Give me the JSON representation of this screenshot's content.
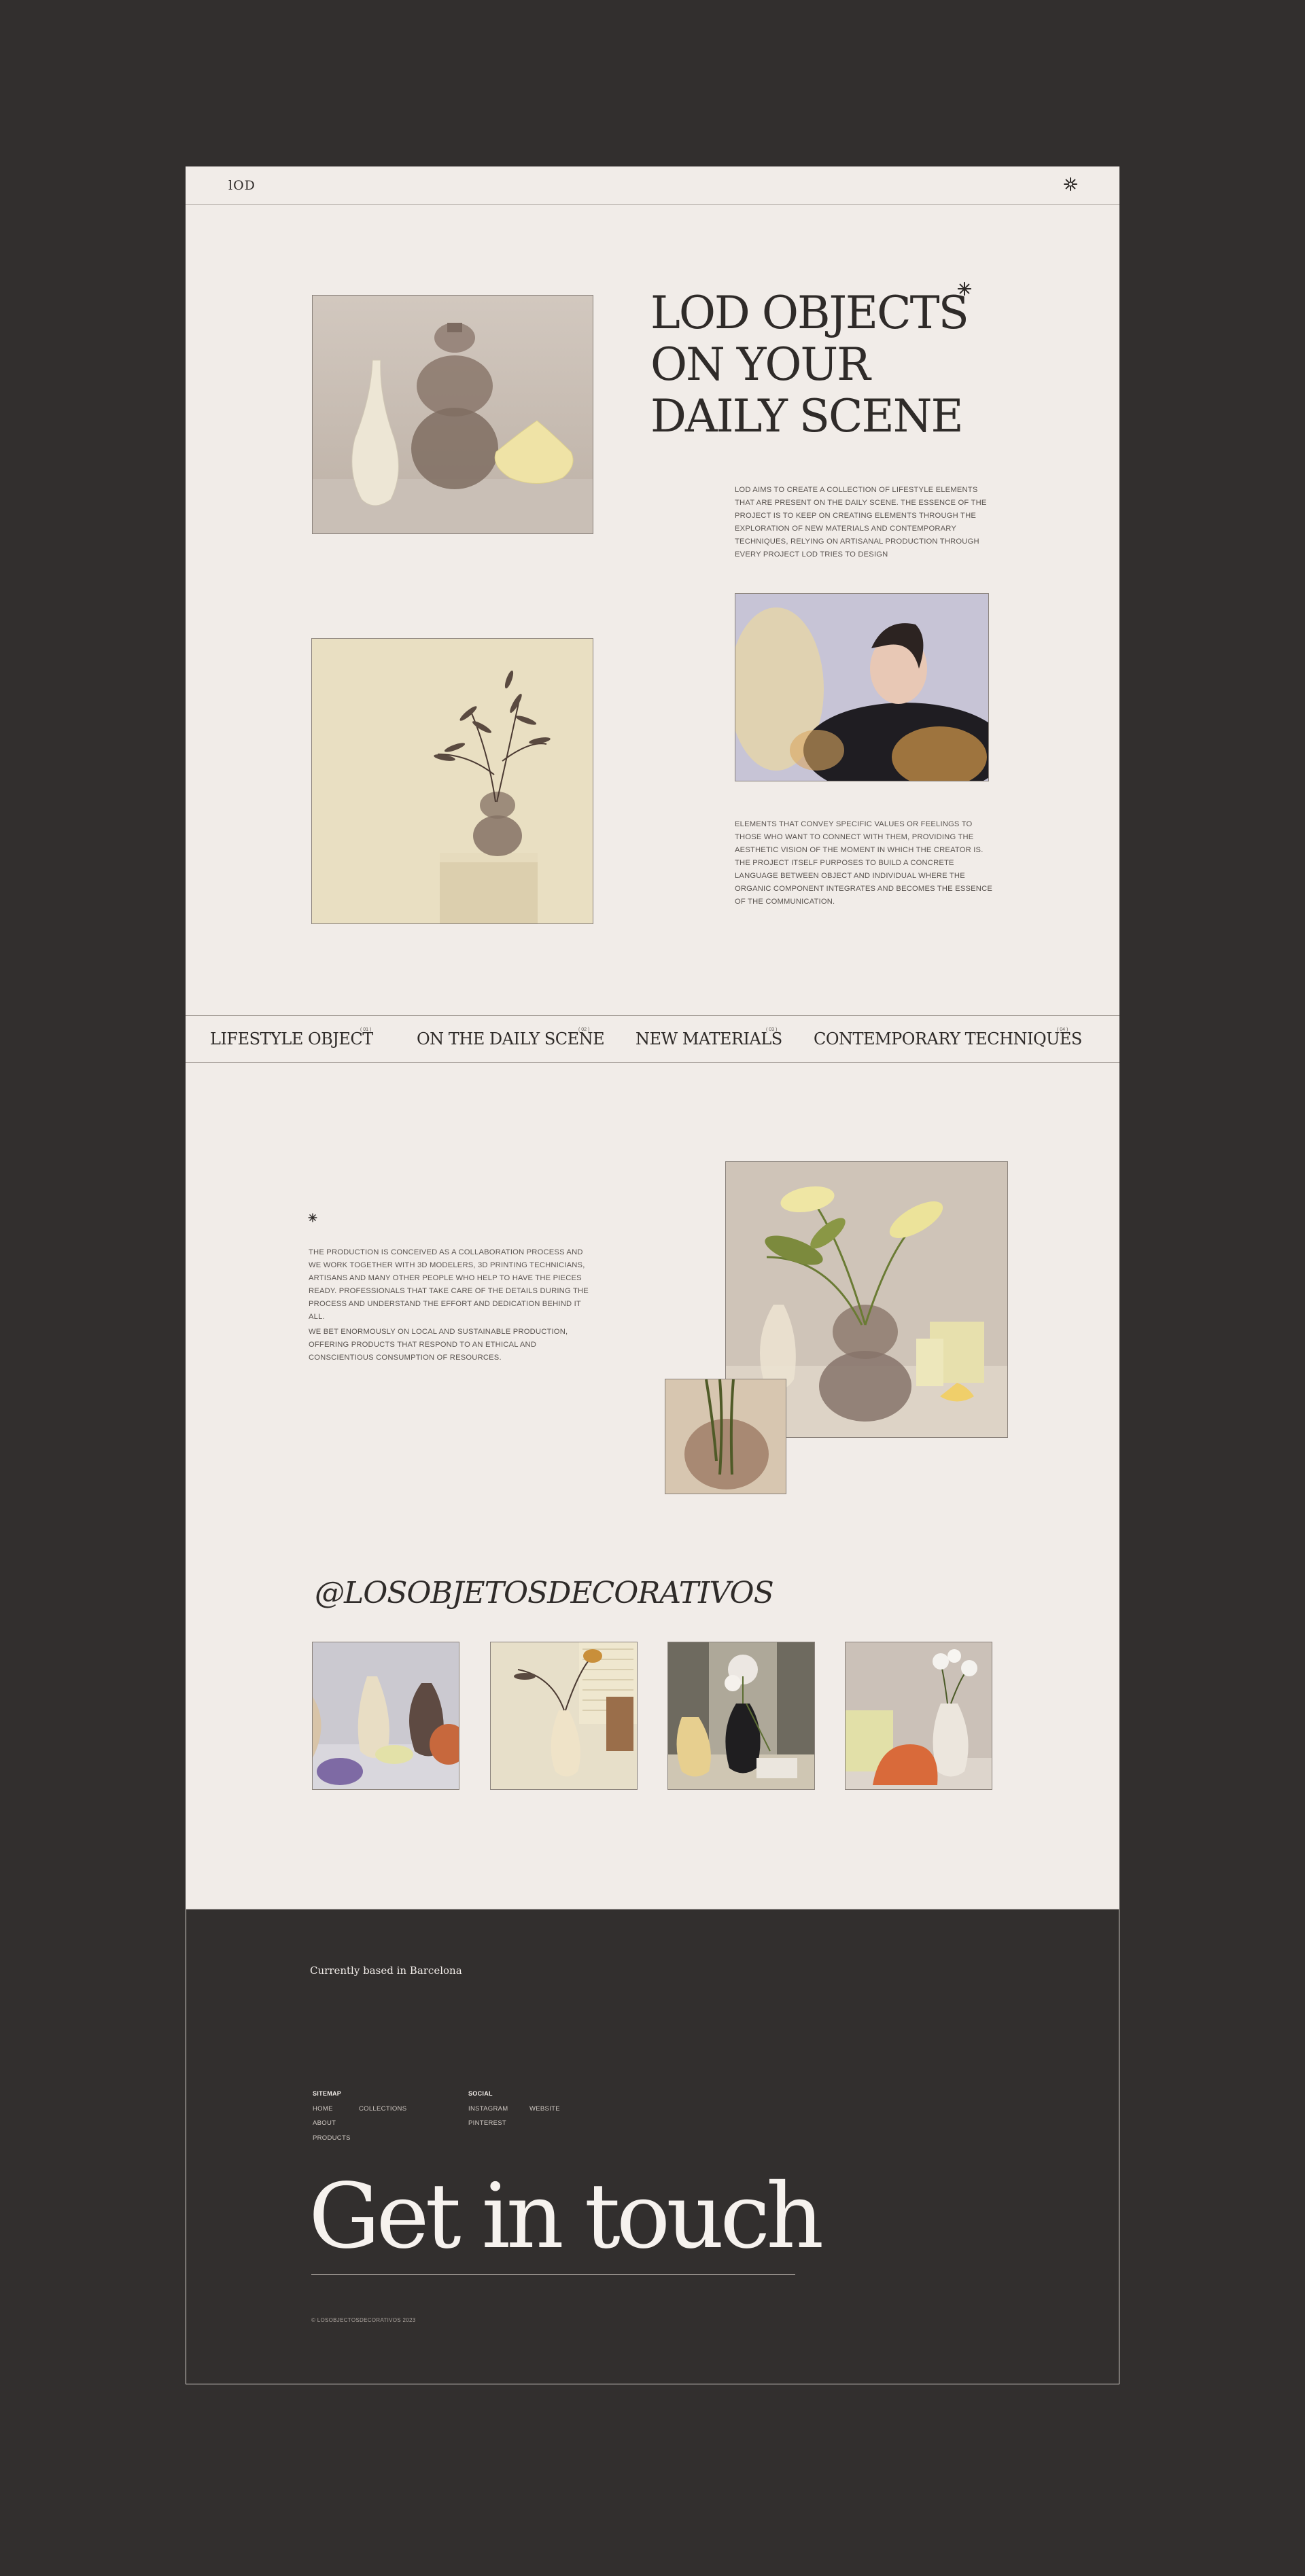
{
  "header": {
    "logo": "lOD",
    "menu_icon": "asterisk-menu-icon"
  },
  "hero": {
    "title_lines": [
      "LOD OBJECTS",
      "ON YOUR",
      "DAILY SCENE"
    ],
    "intro": "LOD AIMS TO CREATE A COLLECTION OF LIFESTYLE ELEMENTS THAT ARE PRESENT ON THE DAILY SCENE. THE ESSENCE OF THE PROJECT IS TO KEEP ON CREATING ELEMENTS THROUGH THE EXPLORATION OF NEW MATERIALS AND CONTEMPORARY TECHNIQUES, RELYING ON ARTISANAL PRODUCTION THROUGH EVERY PROJECT LOD TRIES TO DESIGN",
    "body": "ELEMENTS THAT CONVEY SPECIFIC VALUES OR FEELINGS TO THOSE WHO WANT TO CONNECT WITH THEM, PROVIDING THE AESTHETIC VISION OF THE MOMENT IN WHICH THE CREATOR IS. THE PROJECT ITSELF PURPOSES TO BUILD A CONCRETE LANGUAGE BETWEEN OBJECT AND INDIVIDUAL WHERE THE ORGANIC COMPONENT INTEGRATES AND BECOMES THE ESSENCE OF THE COMMUNICATION."
  },
  "categories": [
    {
      "label": "LIFESTYLE OBJECT",
      "num": "( 01 )"
    },
    {
      "label": "ON THE DAILY SCENE",
      "num": "( 02 )"
    },
    {
      "label": "NEW MATERIALS",
      "num": "( 03 )"
    },
    {
      "label": "CONTEMPORARY TECHNIQUES",
      "num": "( 04 )"
    }
  ],
  "production": {
    "p1": "THE PRODUCTION IS CONCEIVED AS A COLLABORATION PROCESS AND WE WORK TOGETHER WITH 3D MODELERS, 3D PRINTING TECHNICIANS, ARTISANS AND MANY OTHER PEOPLE WHO HELP TO HAVE THE PIECES READY. PROFESSIONALS THAT TAKE CARE OF THE DETAILS DURING THE PROCESS AND UNDERSTAND THE EFFORT AND DEDICATION BEHIND IT ALL.",
    "p2": "WE BET ENORMOUSLY ON LOCAL AND SUSTAINABLE PRODUCTION, OFFERING PRODUCTS THAT RESPOND TO AN ETHICAL AND CONSCIENTIOUS CONSUMPTION OF RESOURCES."
  },
  "instagram": {
    "handle": "@LOSOBJETOSDECORATIVOS"
  },
  "footer": {
    "based": "Currently based in Barcelona",
    "sitemap_title": "SITEMAP",
    "sitemap": [
      "HOME",
      "COLLECTIONS",
      "ABOUT",
      "PRODUCTS"
    ],
    "social_title": "SOCIAL",
    "social": [
      "INSTAGRAM",
      "WEBSITE",
      "PINTEREST"
    ],
    "cta": "Get in touch",
    "copyright": "© LOSOBJECTOSDECORATIVOS 2023"
  },
  "colors": {
    "page_bg": "#f1ece8",
    "outer_bg": "#322f2e",
    "text": "#2f2b29"
  }
}
